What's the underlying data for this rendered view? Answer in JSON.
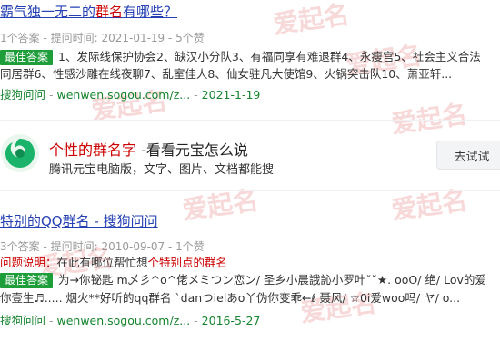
{
  "results": [
    {
      "title_pre": "霸气独一无二的",
      "title_em": "群名",
      "title_post": "有哪些？",
      "meta": "1个答案 - 提问时间: 2021-01-19 - 5个赞",
      "badge": "最佳答案",
      "snippet_line1": "1、发际线保护协会2、缺汉小分队3、有福同享有难退群4、永瘦宫5、社会主义合法",
      "snippet_line2": "同居群6、性感沙雕在线夜聊7、乱室佳人8、仙女驻凡大使馆9、火锅突击队10、萧亚轩...",
      "source_name": "搜狗问问",
      "source_url": "wenwen.sogou.com/z...",
      "source_date": "2021-1-19"
    },
    {
      "title": "特别的QQ群名 - 搜狗问问",
      "meta": "3个答案 - 提问时间: 2010-09-07 - 1个赞",
      "question_label": "问题说明：",
      "question_pre": "在此有哪位帮忙想",
      "question_em": "个特别点的群名",
      "badge": "最佳答案",
      "snippet_line1": "为→你铋匙 m乄彡^o^佬メミつン恋ン/ 圣乡小晨誐訫小罗叶ˇ˘★. ooO/ 绝/ Lov的爱",
      "snippet_line2": "你壹生♬..... 烟火**好听的qq群名 ˋdanつielあo丫伪你变乖←ℓ 聂风/ ☆0i爱woo吗/ ヤ/ o...",
      "source_name": "搜狗问问",
      "source_url": "wenwen.sogou.com/z...",
      "source_date": "2016-5-27"
    }
  ],
  "ad": {
    "title_em": "个性的群名字",
    "title_post": " -看看元宝怎么说",
    "desc": "腾讯元宝电脑版，文字、图片、文档都能搜",
    "button": "去试试",
    "logo_icon": "yuanbao-logo-icon"
  },
  "watermark": "爱起名",
  "colors": {
    "link": "#2440b3",
    "highlight": "#c00000",
    "badge": "#1e9e3a",
    "source": "#16852f"
  }
}
